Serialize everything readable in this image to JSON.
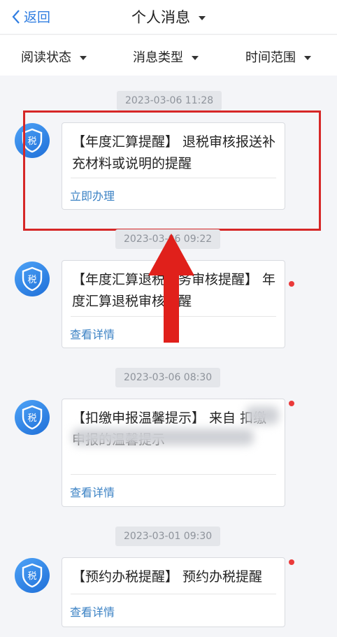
{
  "header": {
    "back_label": "返回",
    "title": "个人消息"
  },
  "filters": [
    "阅读状态",
    "消息类型",
    "时间范围"
  ],
  "avatar_glyph": "税",
  "messages": [
    {
      "time": "2023-03-06 11:28",
      "text": "【年度汇算提醒】 退税审核报送补充材料或说明的提醒",
      "action": "立即办理",
      "unread": false
    },
    {
      "time": "2023-03-06 09:22",
      "text": "【年度汇算退税税务审核提醒】 年度汇算退税审核提醒",
      "action": "查看详情",
      "unread": true
    },
    {
      "time": "2023-03-06 08:30",
      "text": "【扣缴申报温馨提示】 来自 扣缴申报的温馨提示",
      "action": "查看详情",
      "unread": true
    },
    {
      "time": "2023-03-01 09:30",
      "text": "【预约办税提醒】 预约办税提醒",
      "action": "查看详情",
      "unread": true
    }
  ],
  "colors": {
    "accent": "#2f7de1",
    "link": "#3b82c4",
    "unread_dot": "#ea3a3a",
    "annotation": "#d62727"
  }
}
